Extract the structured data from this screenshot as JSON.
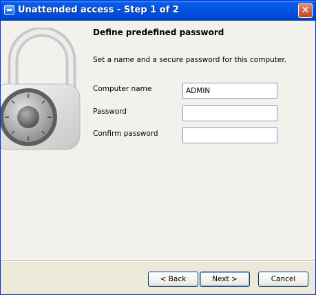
{
  "window": {
    "title": "Unattended access - Step 1 of 2",
    "close_glyph": "✕"
  },
  "icons": {
    "app": "teamviewer-app-icon",
    "lock": "padlock-icon"
  },
  "page": {
    "heading": "Define predefined password",
    "description": "Set a name and a secure password for this computer."
  },
  "form": {
    "computer_name": {
      "label": "Computer name",
      "value": "ADMIN"
    },
    "password": {
      "label": "Password",
      "value": ""
    },
    "confirm_password": {
      "label": "Confirm password",
      "value": ""
    }
  },
  "buttons": {
    "back": "< Back",
    "next": "Next >",
    "cancel": "Cancel"
  },
  "colors": {
    "titlebar": "#0054e3",
    "close_button": "#c4421f",
    "dialog_background": "#ece9d8"
  }
}
